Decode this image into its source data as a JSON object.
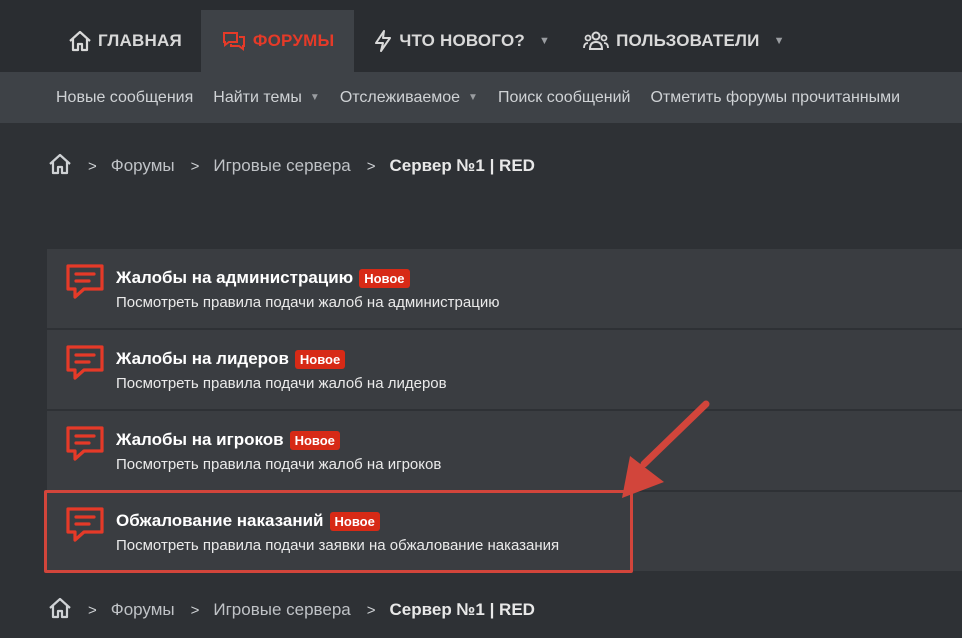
{
  "nav": {
    "tabs": [
      {
        "label": "ГЛАВНАЯ",
        "icon": "home-icon",
        "active": false,
        "dropdown": false
      },
      {
        "label": "ФОРУМЫ",
        "icon": "comments-icon",
        "active": true,
        "dropdown": false
      },
      {
        "label": "ЧТО НОВОГО?",
        "icon": "bolt-icon",
        "active": false,
        "dropdown": true
      },
      {
        "label": "ПОЛЬЗОВАТЕЛИ",
        "icon": "users-icon",
        "active": false,
        "dropdown": true
      }
    ]
  },
  "subnav": {
    "items": [
      {
        "label": "Новые сообщения",
        "dropdown": false
      },
      {
        "label": "Найти темы",
        "dropdown": true
      },
      {
        "label": "Отслеживаемое",
        "dropdown": true
      },
      {
        "label": "Поиск сообщений",
        "dropdown": false
      },
      {
        "label": "Отметить форумы прочитанными",
        "dropdown": false
      }
    ]
  },
  "breadcrumb": {
    "items": [
      "Форумы",
      "Игровые сервера"
    ],
    "current": "Сервер №1 | RED"
  },
  "forums": [
    {
      "title": "Жалобы на администрацию",
      "badge": "Новое",
      "desc": "Посмотреть правила подачи жалоб на администрацию"
    },
    {
      "title": "Жалобы на лидеров",
      "badge": "Новое",
      "desc": "Посмотреть правила подачи жалоб на лидеров"
    },
    {
      "title": "Жалобы на игроков",
      "badge": "Новое",
      "desc": "Посмотреть правила подачи жалоб на игроков"
    },
    {
      "title": "Обжалование наказаний",
      "badge": "Новое",
      "desc": "Посмотреть правила подачи заявки на обжалование наказания"
    }
  ],
  "colors": {
    "accent": "#e53a28",
    "badge": "#d72a16",
    "annotation": "#d2453b"
  }
}
